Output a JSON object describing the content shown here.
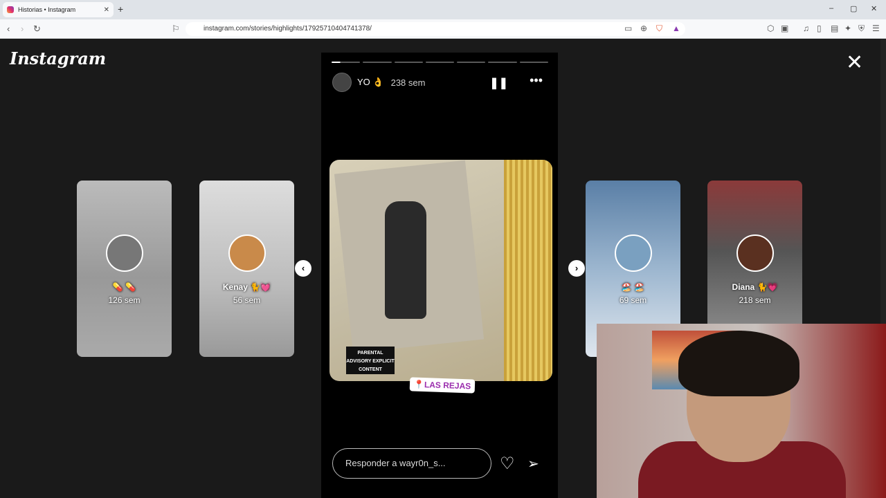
{
  "browser": {
    "tab_title": "Historias • Instagram",
    "tab_close": "✕",
    "new_tab": "+",
    "url": "instagram.com/stories/highlights/17925710404741378/",
    "window_controls": [
      "–",
      "▢",
      "✕"
    ]
  },
  "page": {
    "logo": "Instagram",
    "close_label": "✕"
  },
  "story": {
    "username": "YO 👌",
    "time": "238 sem",
    "segments": 7,
    "active_segment": 1,
    "active_progress": 0.3,
    "advisory_text": "PARENTAL ADVISORY EXPLICIT CONTENT",
    "location_sticker": "📍LAS REJAS",
    "reply_placeholder": "Responder a wayr0n_s..."
  },
  "side_stories": [
    {
      "name": "💊 💊",
      "time": "126 sem"
    },
    {
      "name": "Kenay 🐈💓",
      "time": "56 sem"
    },
    {
      "name": "🏖️ 🏖️",
      "time": "69 sem"
    },
    {
      "name": "Diana 🐈💗",
      "time": "218 sem"
    }
  ],
  "icons": {
    "pause": "pause-icon",
    "more": "more-icon",
    "heart": "heart-icon",
    "send": "send-icon"
  }
}
